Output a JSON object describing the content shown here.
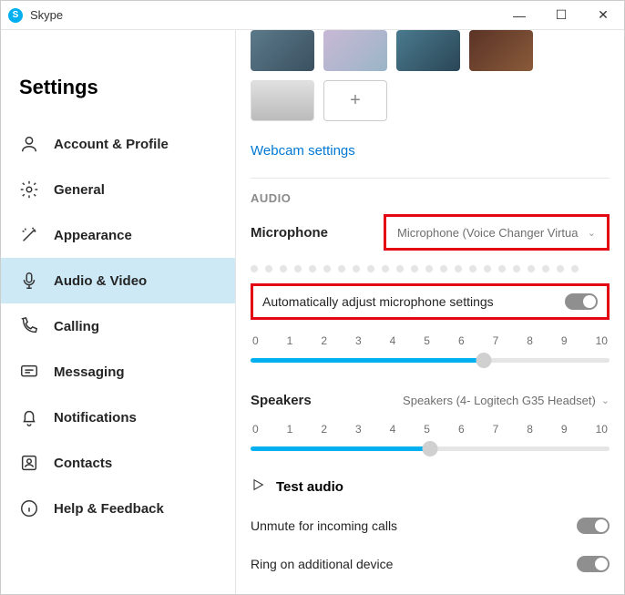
{
  "window": {
    "title": "Skype"
  },
  "sidebar": {
    "heading": "Settings",
    "items": [
      {
        "label": "Account & Profile"
      },
      {
        "label": "General"
      },
      {
        "label": "Appearance"
      },
      {
        "label": "Audio & Video"
      },
      {
        "label": "Calling"
      },
      {
        "label": "Messaging"
      },
      {
        "label": "Notifications"
      },
      {
        "label": "Contacts"
      },
      {
        "label": "Help & Feedback"
      }
    ]
  },
  "main": {
    "webcam_link": "Webcam settings",
    "audio_section": "AUDIO",
    "microphone_label": "Microphone",
    "microphone_value": "Microphone (Voice Changer Virtua",
    "auto_adjust_label": "Automatically adjust microphone settings",
    "mic_slider": {
      "ticks": [
        "0",
        "1",
        "2",
        "3",
        "4",
        "5",
        "6",
        "7",
        "8",
        "9",
        "10"
      ],
      "value": 6.5
    },
    "speakers_label": "Speakers",
    "speakers_value": "Speakers (4- Logitech G35 Headset)",
    "spk_slider": {
      "ticks": [
        "0",
        "1",
        "2",
        "3",
        "4",
        "5",
        "6",
        "7",
        "8",
        "9",
        "10"
      ],
      "value": 5
    },
    "test_audio": "Test audio",
    "unmute_label": "Unmute for incoming calls",
    "ring_label": "Ring on additional device"
  }
}
